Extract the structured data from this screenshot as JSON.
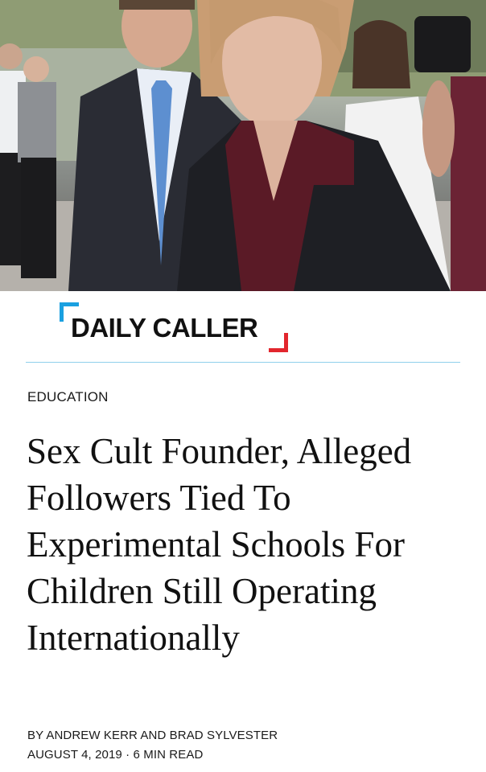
{
  "masthead": {
    "logo_text": "DAILY CALLER",
    "accent_blue": "#1aa0e0",
    "accent_red": "#e2262d",
    "divider_color": "#8fd0ec"
  },
  "article": {
    "category": "EDUCATION",
    "headline": "Sex Cult Founder, Alleged Followers Tied To Experimental Schools For Children Still Operating Internationally",
    "byline": "BY ANDREW KERR AND BRAD SYLVESTER",
    "date": "AUGUST 4, 2019",
    "separator": "·",
    "read_time": "6 MIN READ"
  }
}
